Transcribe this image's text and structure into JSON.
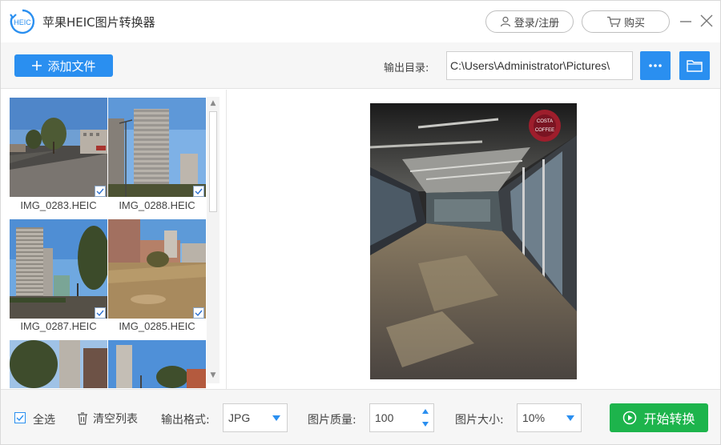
{
  "app": {
    "title": "苹果HEIC图片转换器",
    "logo_text": "HEIC"
  },
  "header": {
    "login_label": "登录/注册",
    "buy_label": "购买"
  },
  "toolbar": {
    "add_file_label": "添加文件",
    "output_dir_label": "输出目录:",
    "output_dir_value": "C:\\Users\\Administrator\\Pictures\\",
    "more_label": "···"
  },
  "files": [
    {
      "name": "IMG_0283.HEIC",
      "checked": true
    },
    {
      "name": "IMG_0288.HEIC",
      "checked": true
    },
    {
      "name": "IMG_0287.HEIC",
      "checked": true
    },
    {
      "name": "IMG_0285.HEIC",
      "checked": true
    }
  ],
  "bottom": {
    "select_all_label": "全选",
    "clear_list_label": "清空列表",
    "format_label": "输出格式:",
    "format_value": "JPG",
    "quality_label": "图片质量:",
    "quality_value": "100",
    "size_label": "图片大小:",
    "size_value": "10%",
    "start_label": "开始转换"
  },
  "colors": {
    "accent": "#2a8ff0",
    "start": "#1db44c"
  }
}
